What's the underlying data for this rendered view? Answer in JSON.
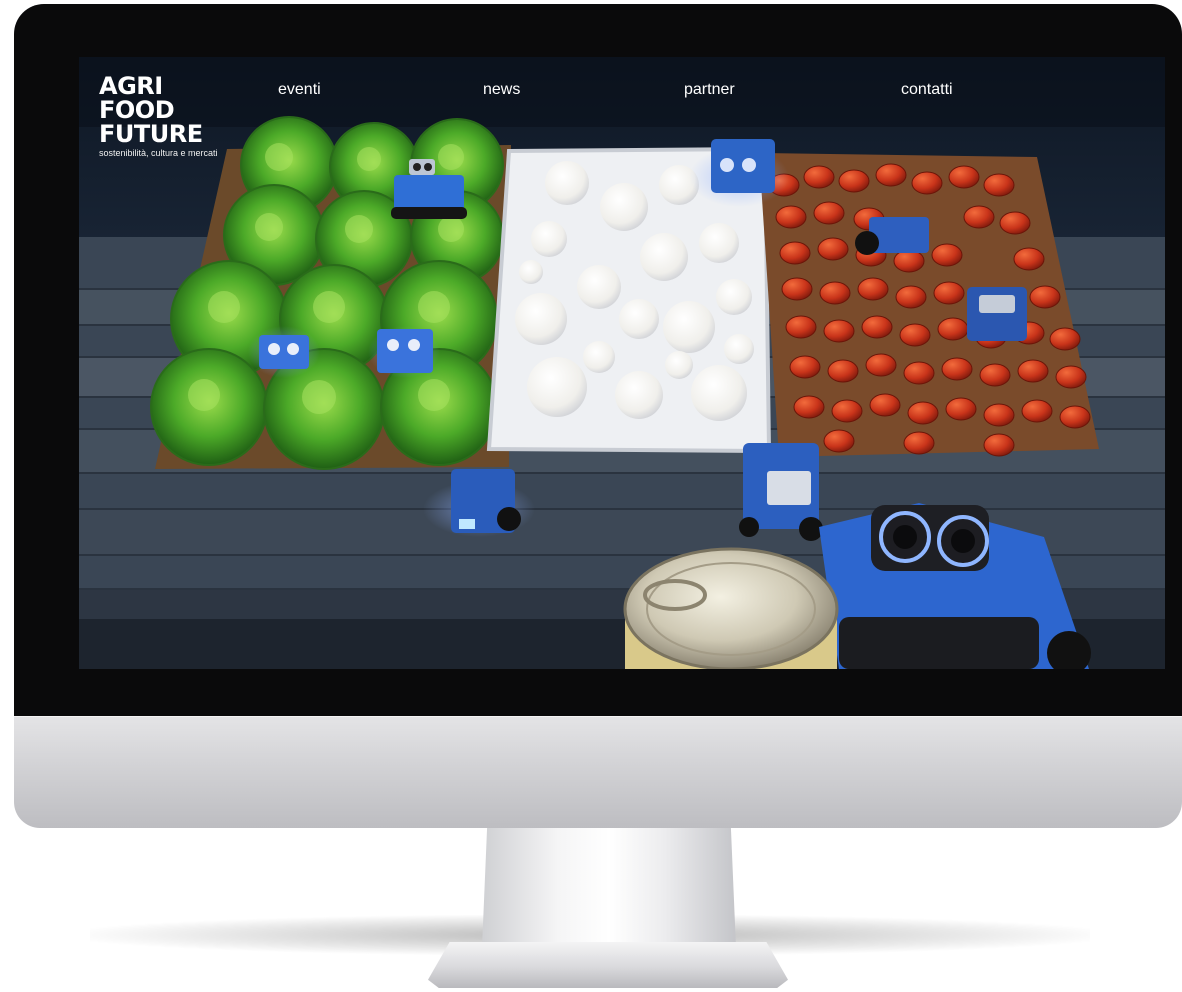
{
  "site": {
    "logo_lines": [
      "AGRI",
      "FOOD",
      "FUTURE"
    ],
    "tagline": "sostenibilità, cultura e mercati"
  },
  "nav": {
    "items": [
      "eventi",
      "news",
      "partner",
      "contatti"
    ]
  },
  "hero": {
    "image": "crates of green lettuce, white mozzarella and red tomatoes on a wooden table with small blue educational robots and a tin can"
  },
  "colors": {
    "bezel": "#0a0a0b",
    "lettuce": "#4fae2a",
    "mozzarella": "#f2f1ee",
    "tomato": "#cf3c16",
    "robot_blue": "#2b63c9",
    "text": "#ffffff"
  }
}
